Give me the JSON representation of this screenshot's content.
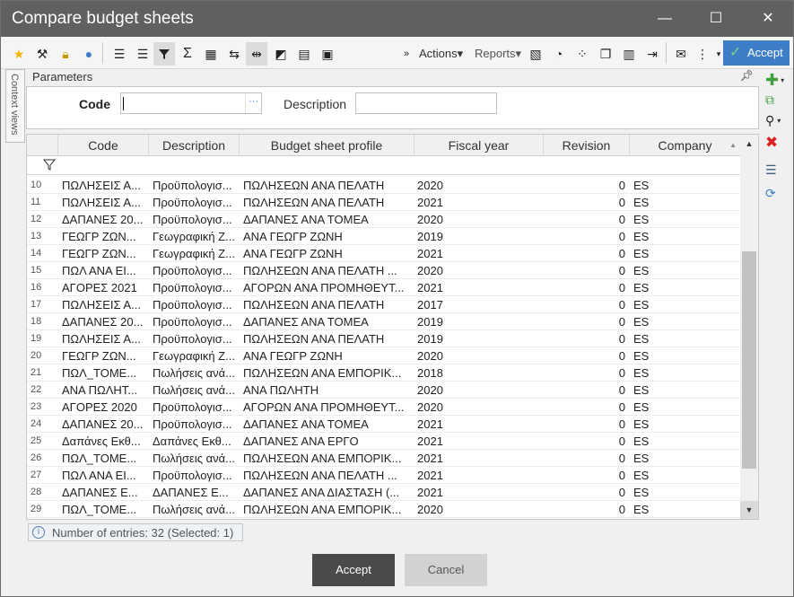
{
  "window": {
    "title": "Compare budget sheets",
    "minimize_glyph": "—",
    "maximize_glyph": "☐",
    "close_glyph": "✕"
  },
  "toolbar": {
    "actions_label": "Actions",
    "reports_label": "Reports",
    "accept_label": "Accept",
    "icons": [
      "star-icon",
      "tools-icon",
      "lock-icon",
      "lightbulb-icon",
      "outdent-icon",
      "indent-icon",
      "filter-icon",
      "sigma-icon",
      "table-calc-icon",
      "export-icon",
      "resize-icon",
      "contrast-icon",
      "calculator-icon",
      "save-icon",
      "overflow-icon",
      "report-icon",
      "chart-icon",
      "scatter-icon",
      "copy-icon",
      "excel-icon",
      "export-file-icon",
      "envelope-icon",
      "more-vert-icon"
    ]
  },
  "context_tab": {
    "label": "Context views"
  },
  "parameters": {
    "header": "Parameters",
    "code_label": "Code",
    "code_value": "",
    "description_label": "Description",
    "description_value": ""
  },
  "grid": {
    "columns": [
      "Code",
      "Description",
      "Budget sheet profile",
      "Fiscal year",
      "Revision",
      "Company"
    ],
    "rows": [
      {
        "n": "10",
        "code": "ΠΩΛΗΣΕΙΣ Α...",
        "desc": "Προϋπολογισ...",
        "profile": "ΠΩΛΗΣΕΩΝ ΑΝΑ ΠΕΛΑΤΗ",
        "fy": "2020",
        "rev": "0",
        "comp": "ES"
      },
      {
        "n": "11",
        "code": "ΠΩΛΗΣΕΙΣ Α...",
        "desc": "Προϋπολογισ...",
        "profile": "ΠΩΛΗΣΕΩΝ ΑΝΑ ΠΕΛΑΤΗ",
        "fy": "2021",
        "rev": "0",
        "comp": "ES"
      },
      {
        "n": "12",
        "code": "ΔΑΠΑΝΕΣ 20...",
        "desc": "Προϋπολογισ...",
        "profile": "ΔΑΠΑΝΕΣ ΑΝΑ ΤΟΜΕΑ",
        "fy": "2020",
        "rev": "0",
        "comp": "ES"
      },
      {
        "n": "13",
        "code": "ΓΕΩΓΡ ΖΩΝ...",
        "desc": "Γεωγραφική Ζ...",
        "profile": "ΑΝΑ ΓΕΩΓΡ ΖΩΝΗ",
        "fy": "2019",
        "rev": "0",
        "comp": "ES"
      },
      {
        "n": "14",
        "code": "ΓΕΩΓΡ ΖΩΝ...",
        "desc": "Γεωγραφική Ζ...",
        "profile": "ΑΝΑ ΓΕΩΓΡ ΖΩΝΗ",
        "fy": "2021",
        "rev": "0",
        "comp": "ES"
      },
      {
        "n": "15",
        "code": "ΠΩΛ ΑΝΑ ΕΙ...",
        "desc": "Προϋπολογισ...",
        "profile": "ΠΩΛΗΣΕΩΝ ΑΝΑ ΠΕΛΑΤΗ ...",
        "fy": "2020",
        "rev": "0",
        "comp": "ES"
      },
      {
        "n": "16",
        "code": "ΑΓΟΡΕΣ 2021",
        "desc": "Προϋπολογισ...",
        "profile": "ΑΓΟΡΩΝ ΑΝΑ ΠΡΟΜΗΘΕΥΤ...",
        "fy": "2021",
        "rev": "0",
        "comp": "ES"
      },
      {
        "n": "17",
        "code": "ΠΩΛΗΣΕΙΣ Α...",
        "desc": "Προϋπολογισ...",
        "profile": "ΠΩΛΗΣΕΩΝ ΑΝΑ ΠΕΛΑΤΗ",
        "fy": "2017",
        "rev": "0",
        "comp": "ES"
      },
      {
        "n": "18",
        "code": "ΔΑΠΑΝΕΣ 20...",
        "desc": "Προϋπολογισ...",
        "profile": "ΔΑΠΑΝΕΣ ΑΝΑ ΤΟΜΕΑ",
        "fy": "2019",
        "rev": "0",
        "comp": "ES"
      },
      {
        "n": "19",
        "code": "ΠΩΛΗΣΕΙΣ Α...",
        "desc": "Προϋπολογισ...",
        "profile": "ΠΩΛΗΣΕΩΝ ΑΝΑ ΠΕΛΑΤΗ",
        "fy": "2019",
        "rev": "0",
        "comp": "ES"
      },
      {
        "n": "20",
        "code": "ΓΕΩΓΡ ΖΩΝ...",
        "desc": "Γεωγραφική Ζ...",
        "profile": "ΑΝΑ ΓΕΩΓΡ ΖΩΝΗ",
        "fy": "2020",
        "rev": "0",
        "comp": "ES"
      },
      {
        "n": "21",
        "code": "ΠΩΛ_ΤΟΜΕ...",
        "desc": "Πωλήσεις ανά...",
        "profile": "ΠΩΛΗΣΕΩΝ ΑΝΑ ΕΜΠΟΡΙΚ...",
        "fy": "2018",
        "rev": "0",
        "comp": "ES"
      },
      {
        "n": "22",
        "code": "ΑΝΑ ΠΩΛΗΤ...",
        "desc": "Πωλήσεις ανά...",
        "profile": "ΑΝΑ ΠΩΛΗΤΗ",
        "fy": "2020",
        "rev": "0",
        "comp": "ES"
      },
      {
        "n": "23",
        "code": "ΑΓΟΡΕΣ 2020",
        "desc": "Προϋπολογισ...",
        "profile": "ΑΓΟΡΩΝ ΑΝΑ ΠΡΟΜΗΘΕΥΤ...",
        "fy": "2020",
        "rev": "0",
        "comp": "ES"
      },
      {
        "n": "24",
        "code": "ΔΑΠΑΝΕΣ 20...",
        "desc": "Προϋπολογισ...",
        "profile": "ΔΑΠΑΝΕΣ ΑΝΑ ΤΟΜΕΑ",
        "fy": "2021",
        "rev": "0",
        "comp": "ES"
      },
      {
        "n": "25",
        "code": "Δαπάνες Εκθ...",
        "desc": "Δαπάνες Εκθ...",
        "profile": "ΔΑΠΑΝΕΣ ΑΝΑ ΕΡΓΟ",
        "fy": "2021",
        "rev": "0",
        "comp": "ES"
      },
      {
        "n": "26",
        "code": "ΠΩΛ_ΤΟΜΕ...",
        "desc": "Πωλήσεις ανά...",
        "profile": "ΠΩΛΗΣΕΩΝ ΑΝΑ ΕΜΠΟΡΙΚ...",
        "fy": "2021",
        "rev": "0",
        "comp": "ES"
      },
      {
        "n": "27",
        "code": "ΠΩΛ ΑΝΑ ΕΙ...",
        "desc": "Προϋπολογισ...",
        "profile": "ΠΩΛΗΣΕΩΝ ΑΝΑ ΠΕΛΑΤΗ ...",
        "fy": "2021",
        "rev": "0",
        "comp": "ES"
      },
      {
        "n": "28",
        "code": "ΔΑΠΑΝΕΣ Ε...",
        "desc": "ΔΑΠΑΝΕΣ Ε...",
        "profile": "ΔΑΠΑΝΕΣ ΑΝΑ ΔΙΑΣΤΑΣΗ (...",
        "fy": "2021",
        "rev": "0",
        "comp": "ES"
      },
      {
        "n": "29",
        "code": "ΠΩΛ_ΤΟΜΕ...",
        "desc": "Πωλήσεις ανά...",
        "profile": "ΠΩΛΗΣΕΩΝ ΑΝΑ ΕΜΠΟΡΙΚ...",
        "fy": "2020",
        "rev": "0",
        "comp": "ES"
      }
    ]
  },
  "status": {
    "text": "Number of entries: 32 (Selected: 1)"
  },
  "footer": {
    "accept_label": "Accept",
    "cancel_label": "Cancel"
  },
  "colors": {
    "titlebar": "#606060",
    "accent": "#3d7ec6",
    "accept_dark": "#4a4a4a"
  }
}
